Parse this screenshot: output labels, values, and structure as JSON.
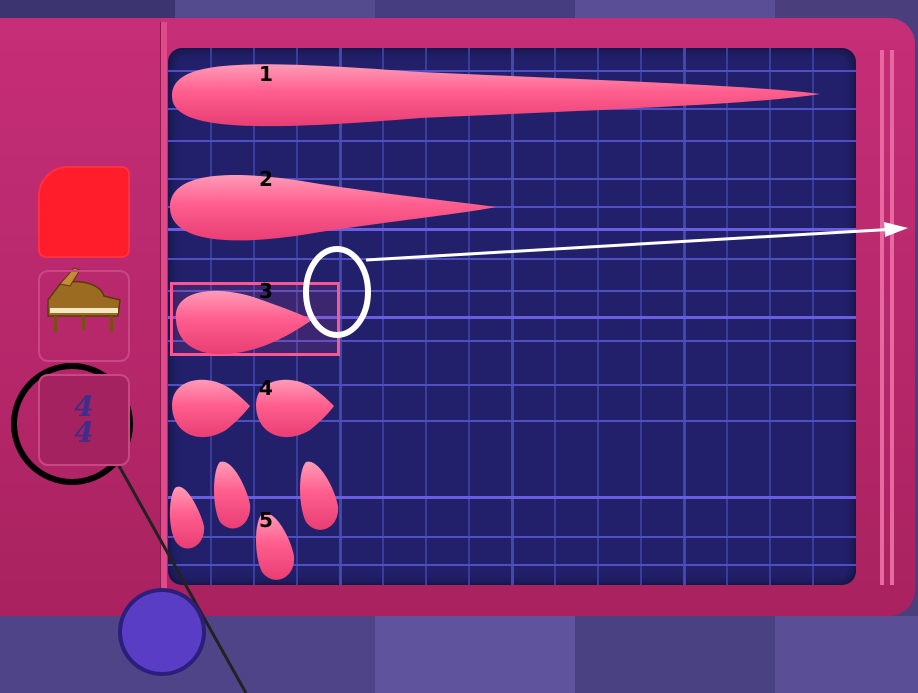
{
  "rows": [
    {
      "label": "1"
    },
    {
      "label": "2"
    },
    {
      "label": "3"
    },
    {
      "label": "4"
    },
    {
      "label": "5"
    }
  ],
  "time_signature": {
    "top": "4",
    "bottom": "4"
  },
  "colors": {
    "frame": "#c62e78",
    "screen": "#22206b",
    "note": "#ff5e8e",
    "color_swatch": "#ff1d2c",
    "play": "#5a3dc5"
  },
  "icons": {
    "piano": "piano-icon",
    "play": "play-icon"
  }
}
